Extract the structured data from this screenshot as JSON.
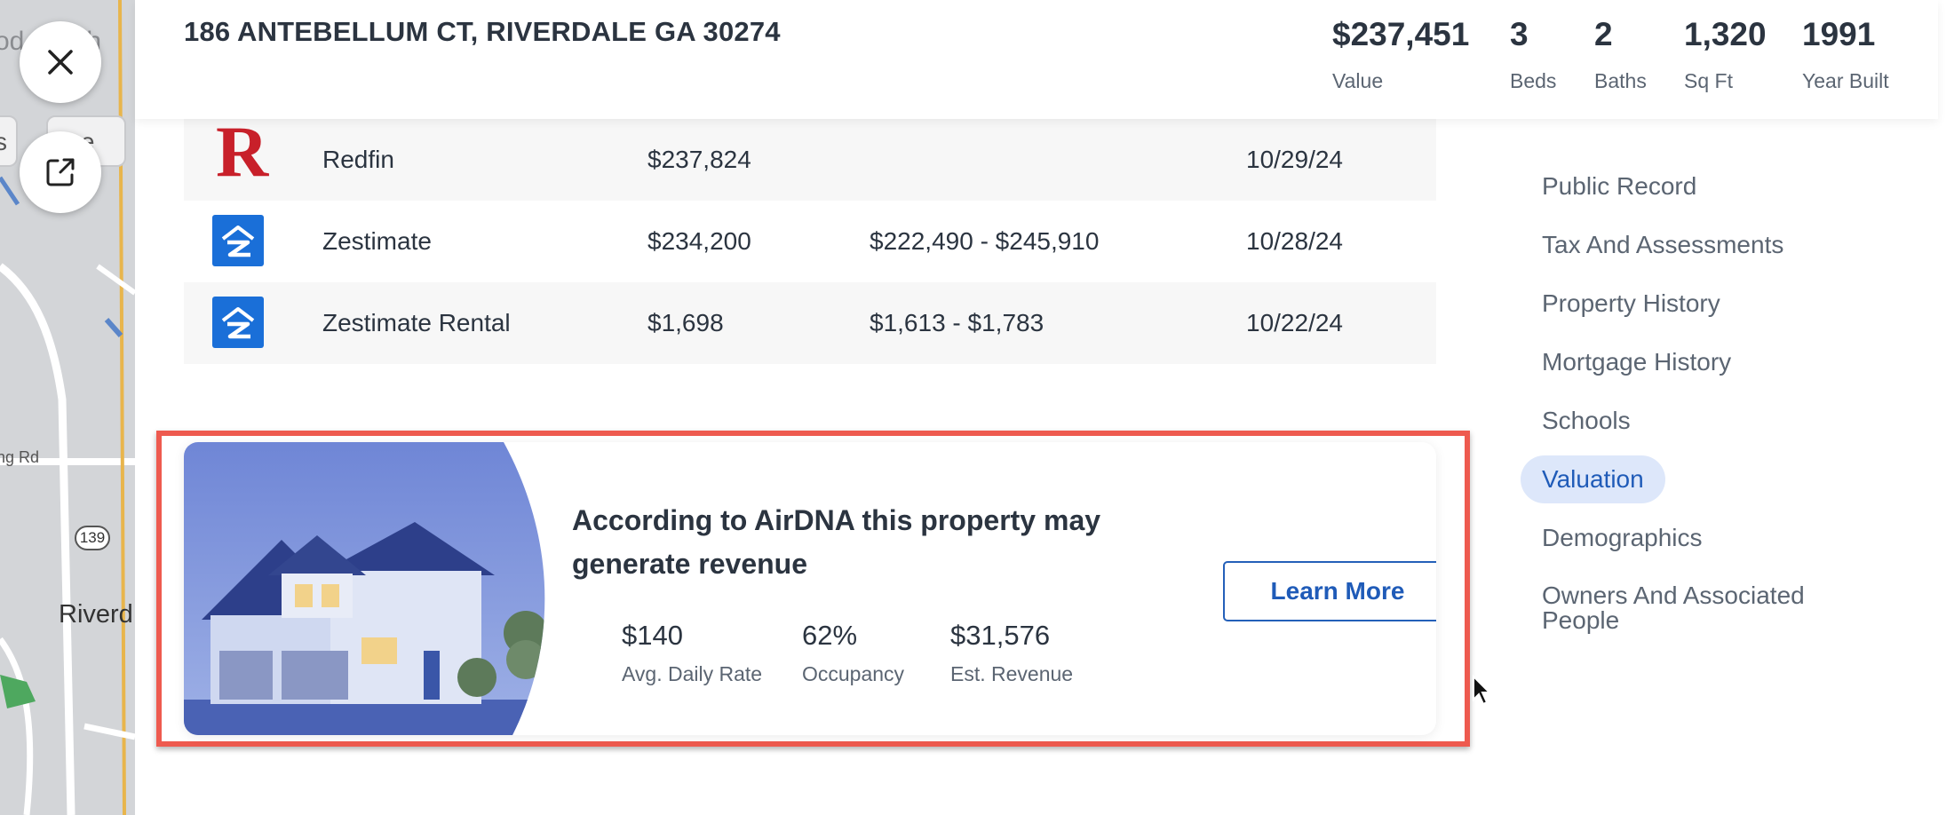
{
  "map": {
    "neighborhood_fragment": "od Neigh",
    "chip_left": "s",
    "chip_right": "ore",
    "road_label": "ng Rd",
    "route_shield": "139",
    "place_fragment": "Riverd"
  },
  "float_buttons": {
    "close_icon": "close-icon",
    "open_icon": "external-link-icon"
  },
  "header": {
    "address": "186 ANTEBELLUM CT, RIVERDALE GA 30274",
    "stats": [
      {
        "value": "$237,451",
        "label": "Value"
      },
      {
        "value": "3",
        "label": "Beds"
      },
      {
        "value": "2",
        "label": "Baths"
      },
      {
        "value": "1,320",
        "label": "Sq Ft"
      },
      {
        "value": "1991",
        "label": "Year Built"
      }
    ]
  },
  "valuations": [
    {
      "source": "Redfin",
      "logo": "redfin-logo",
      "value": "$237,824",
      "range": "",
      "date": "10/29/24"
    },
    {
      "source": "Zestimate",
      "logo": "zillow-logo",
      "value": "$234,200",
      "range": "$222,490 - $245,910",
      "date": "10/28/24"
    },
    {
      "source": "Zestimate Rental",
      "logo": "zillow-logo",
      "value": "$1,698",
      "range": "$1,613 - $1,783",
      "date": "10/22/24"
    }
  ],
  "airdna": {
    "headline": "According to AirDNA this property may generate revenue",
    "metrics": [
      {
        "value": "$140",
        "label": "Avg. Daily Rate"
      },
      {
        "value": "62%",
        "label": "Occupancy"
      },
      {
        "value": "$31,576",
        "label": "Est. Revenue"
      }
    ],
    "button_label": "Learn More",
    "highlight_color": "#ee5a4f"
  },
  "side_nav": {
    "items": [
      {
        "label": "Public Record",
        "active": false
      },
      {
        "label": "Tax And Assessments",
        "active": false
      },
      {
        "label": "Property History",
        "active": false
      },
      {
        "label": "Mortgage History",
        "active": false
      },
      {
        "label": "Schools",
        "active": false
      },
      {
        "label": "Valuation",
        "active": true
      },
      {
        "label": "Demographics",
        "active": false
      },
      {
        "label": "Owners And Associated People",
        "active": false
      }
    ]
  },
  "colors": {
    "accent": "#1f5bb8",
    "active_nav_bg": "#dde7fa",
    "redfin_red": "#c8202a",
    "zillow_blue": "#1a6fd8"
  }
}
